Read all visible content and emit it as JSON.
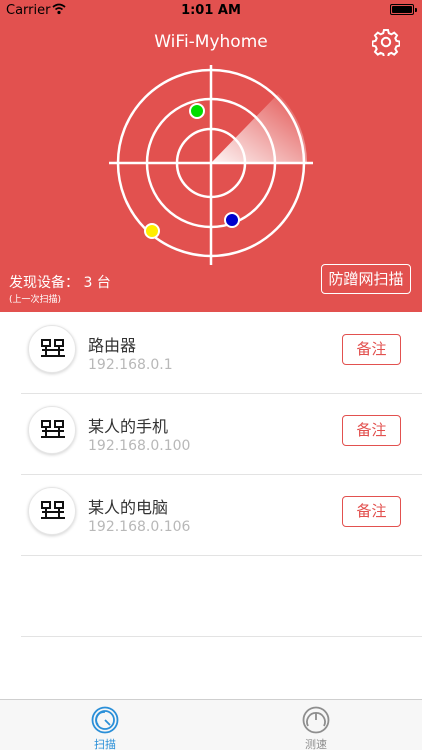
{
  "status_bar": {
    "carrier": "Carrier",
    "time": "1:01 AM"
  },
  "nav": {
    "title": "WiFi-Myhome"
  },
  "colors": {
    "accent": "#e2514f",
    "tab_active": "#2a8fd8",
    "tab_inactive": "#8e8e8e"
  },
  "radar": {
    "dots": [
      {
        "color": "#00dd00"
      },
      {
        "color": "#0000cc"
      },
      {
        "color": "#ffee00"
      }
    ]
  },
  "summary": {
    "found_label": "发现设备： 3 台",
    "last_scan": "(上一次扫描)",
    "anti_button": "防蹭网扫描"
  },
  "devices": [
    {
      "name": "路由器",
      "ip": "192.168.0.1",
      "note_label": "备注",
      "icon": "network-icon"
    },
    {
      "name": "某人的手机",
      "ip": "192.168.0.100",
      "note_label": "备注",
      "icon": "network-icon"
    },
    {
      "name": "某人的电脑",
      "ip": "192.168.0.106",
      "note_label": "备注",
      "icon": "network-icon"
    }
  ],
  "tabs": [
    {
      "label": "扫描",
      "icon": "radar-gauge-icon",
      "active": true
    },
    {
      "label": "测速",
      "icon": "speedometer-icon",
      "active": false
    }
  ]
}
